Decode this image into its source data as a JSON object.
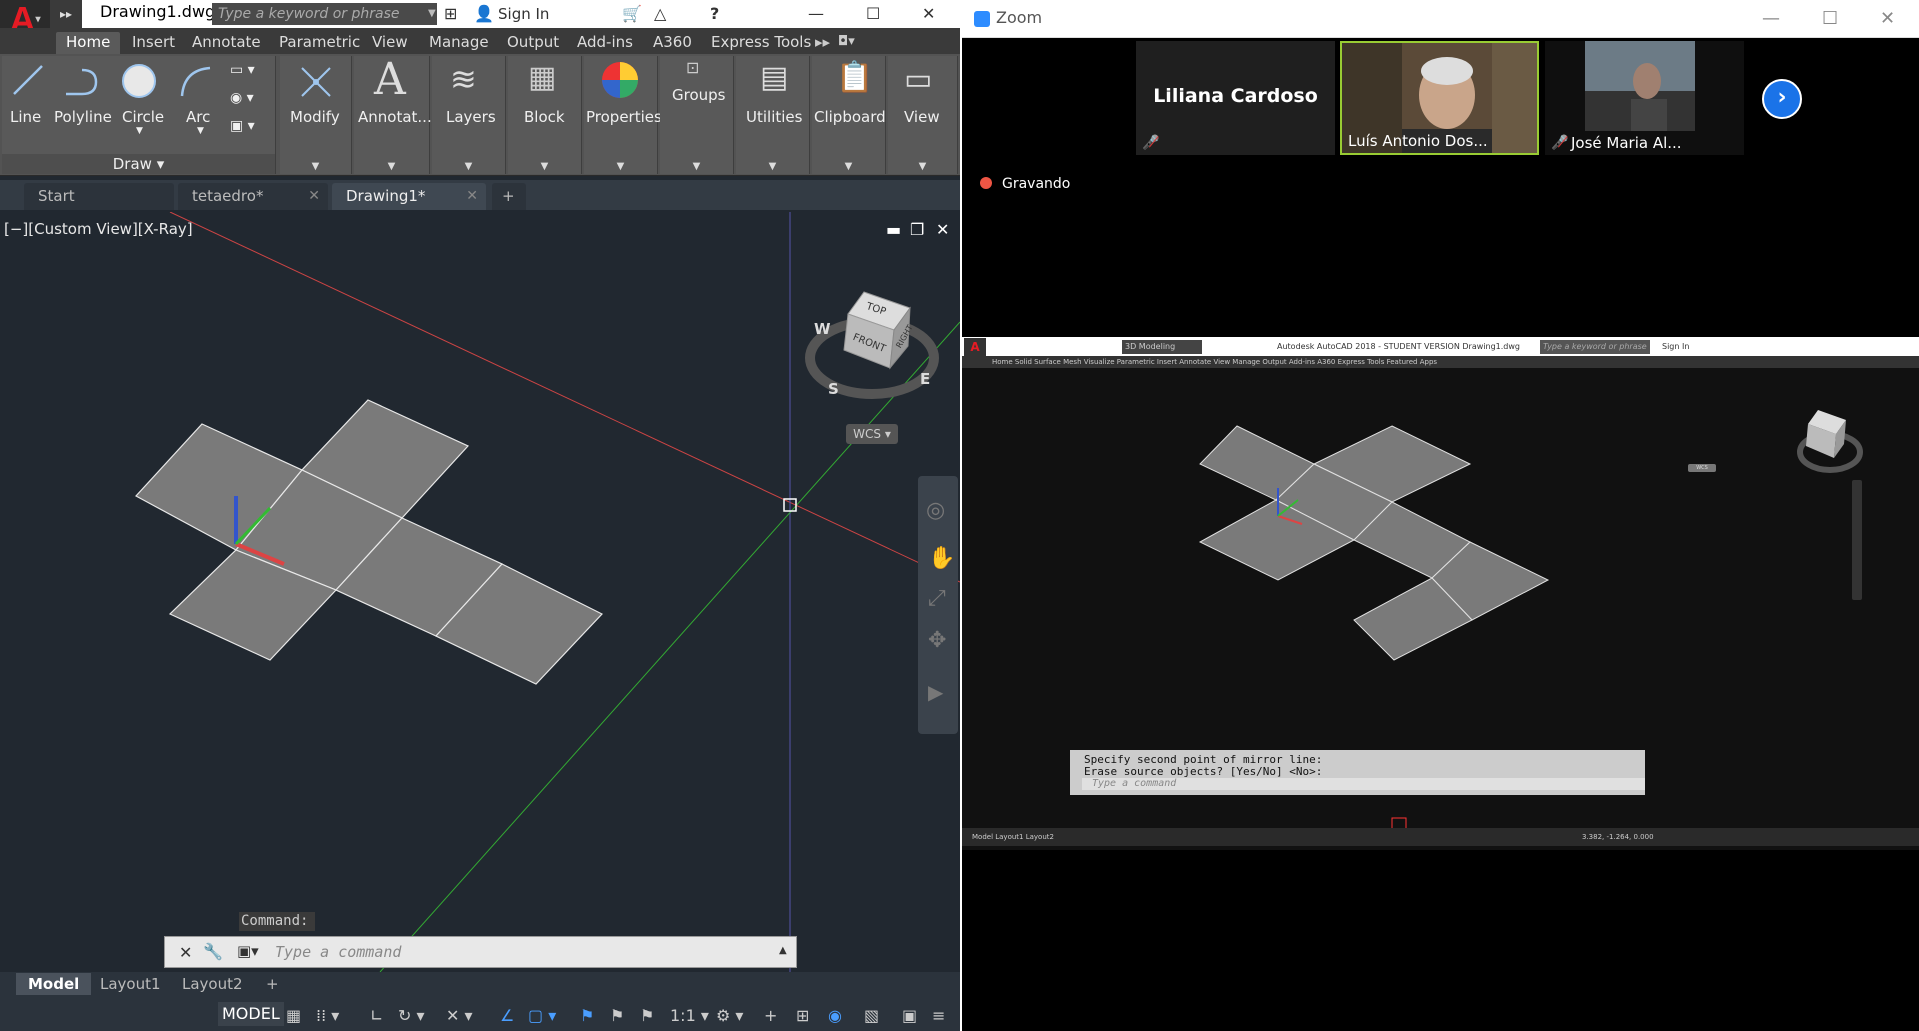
{
  "autocad": {
    "doc_title": "Drawing1.dwg",
    "search_placeholder": "Type a keyword or phrase",
    "sign_in": "Sign In",
    "ribbon_tabs": [
      "Home",
      "Insert",
      "Annotate",
      "Parametric",
      "View",
      "Manage",
      "Output",
      "Add-ins",
      "A360",
      "Express Tools"
    ],
    "tools": {
      "line": "Line",
      "polyline": "Polyline",
      "circle": "Circle",
      "arc": "Arc",
      "modify": "Modify",
      "annotation": "Annotat...",
      "layers": "Layers",
      "block": "Block",
      "properties": "Properties",
      "groups": "Groups",
      "utilities": "Utilities",
      "clipboard": "Clipboard",
      "view": "View"
    },
    "draw_panel": "Draw",
    "file_tabs": [
      "Start",
      "tetaedro*",
      "Drawing1*"
    ],
    "view_label": "[−][Custom View][X-Ray]",
    "viewcube": {
      "top": "TOP",
      "front": "FRONT",
      "right": "RIGHT",
      "w": "W",
      "s": "S",
      "e": "E",
      "wcs": "WCS"
    },
    "command_history": "Command:",
    "command_placeholder": "Type a command",
    "layout_tabs": [
      "Model",
      "Layout1",
      "Layout2"
    ],
    "status_model": "MODEL",
    "status_scale": "1:1"
  },
  "zoom": {
    "app_title": "Zoom",
    "participants": [
      {
        "name": "Liliana Cardoso",
        "muted": true
      },
      {
        "name": "Luís Antonio Dos...",
        "muted": false
      },
      {
        "name": "José Maria Al...",
        "muted": true
      }
    ],
    "recording": "Gravando",
    "shared": {
      "title": "Autodesk AutoCAD 2018 - STUDENT VERSION    Drawing1.dwg",
      "workspace": "3D Modeling",
      "search": "Type a keyword or phrase",
      "signin": "Sign In",
      "tabs": "Home   Solid   Surface   Mesh   Visualize   Parametric   Insert   Annotate   View   Manage   Output   Add-ins   A360   Express Tools   Featured Apps",
      "cmd1": "Specify second point of mirror line:",
      "cmd2": "Erase source objects? [Yes/No] <No>:",
      "cmd_placeholder": "Type a command",
      "layouts": "Model   Layout1   Layout2",
      "coords": "3.382, -1.264, 0.000",
      "wcs": "WCS"
    }
  }
}
